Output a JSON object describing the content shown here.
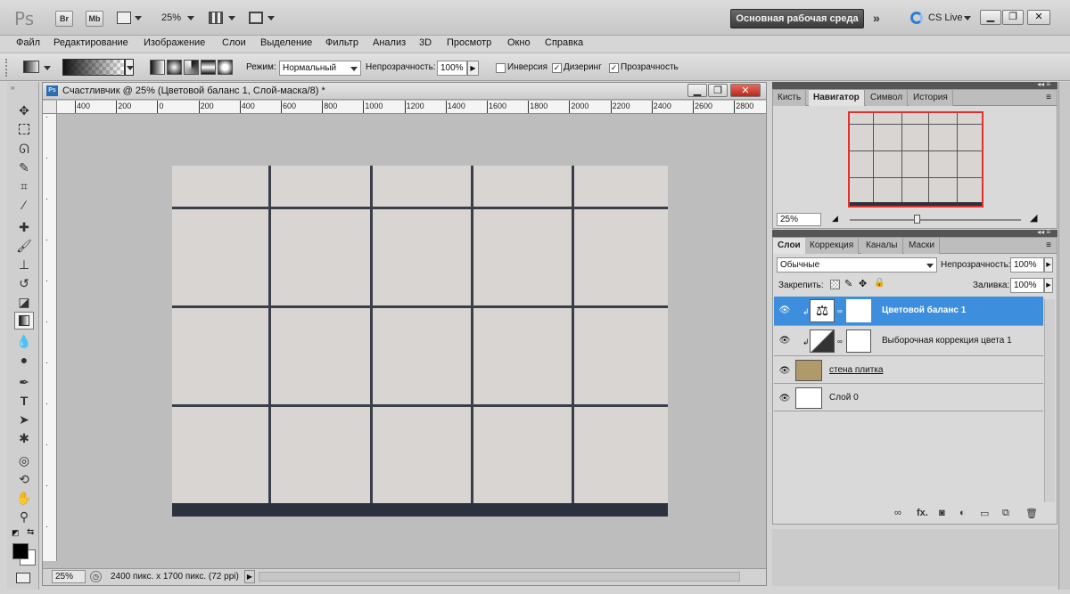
{
  "appbar": {
    "logo": "Ps",
    "br": "Br",
    "mb": "Mb",
    "zoom": "25%",
    "workspace": "Основная рабочая среда",
    "cslive": "CS Live"
  },
  "menu": [
    "Файл",
    "Редактирование",
    "Изображение",
    "Слои",
    "Выделение",
    "Фильтр",
    "Анализ",
    "3D",
    "Просмотр",
    "Окно",
    "Справка"
  ],
  "options": {
    "mode_label": "Режим:",
    "mode_value": "Нормальный",
    "opacity_label": "Непрозрачность:",
    "opacity_value": "100%",
    "inverse_label": "Инверсия",
    "dither_label": "Дизеринг",
    "transparency_label": "Прозрачность",
    "inverse_checked": false,
    "dither_checked": true,
    "transparency_checked": true
  },
  "document": {
    "title": "Счастливчик @ 25% (Цветовой баланс 1, Слой-маска/8) *",
    "ruler_labels": [
      "400",
      "200",
      "0",
      "200",
      "400",
      "600",
      "800",
      "1000",
      "1200",
      "1400",
      "1600",
      "1800",
      "2000",
      "2200",
      "2400",
      "2600",
      "2800"
    ],
    "zoom": "25%",
    "doc_info": "2400 пикс. x 1700 пикс. (72 ppi)"
  },
  "navigator": {
    "tabs": [
      "Кисть",
      "Навигатор",
      "Символ",
      "История"
    ],
    "active_tab": "Навигатор",
    "zoom": "25%"
  },
  "layers_panel": {
    "tabs": [
      "Слои",
      "Коррекция",
      "Каналы",
      "Маски"
    ],
    "active_tab": "Слои",
    "blend_mode": "Обычные",
    "opacity_label": "Непрозрачность:",
    "opacity_value": "100%",
    "lock_label": "Закрепить:",
    "fill_label": "Заливка:",
    "fill_value": "100%",
    "layers": [
      {
        "name": "Цветовой баланс 1",
        "selected": true
      },
      {
        "name": "Выборочная коррекция цвета 1",
        "selected": false
      },
      {
        "name": "стена плитка",
        "selected": false
      },
      {
        "name": "Слой 0",
        "selected": false
      }
    ]
  },
  "colors": {
    "selection": "#3d8fde",
    "tile_line": "#3a3f4a",
    "nav_frame": "#e03030",
    "texture_thumb": "#b09a6a"
  }
}
